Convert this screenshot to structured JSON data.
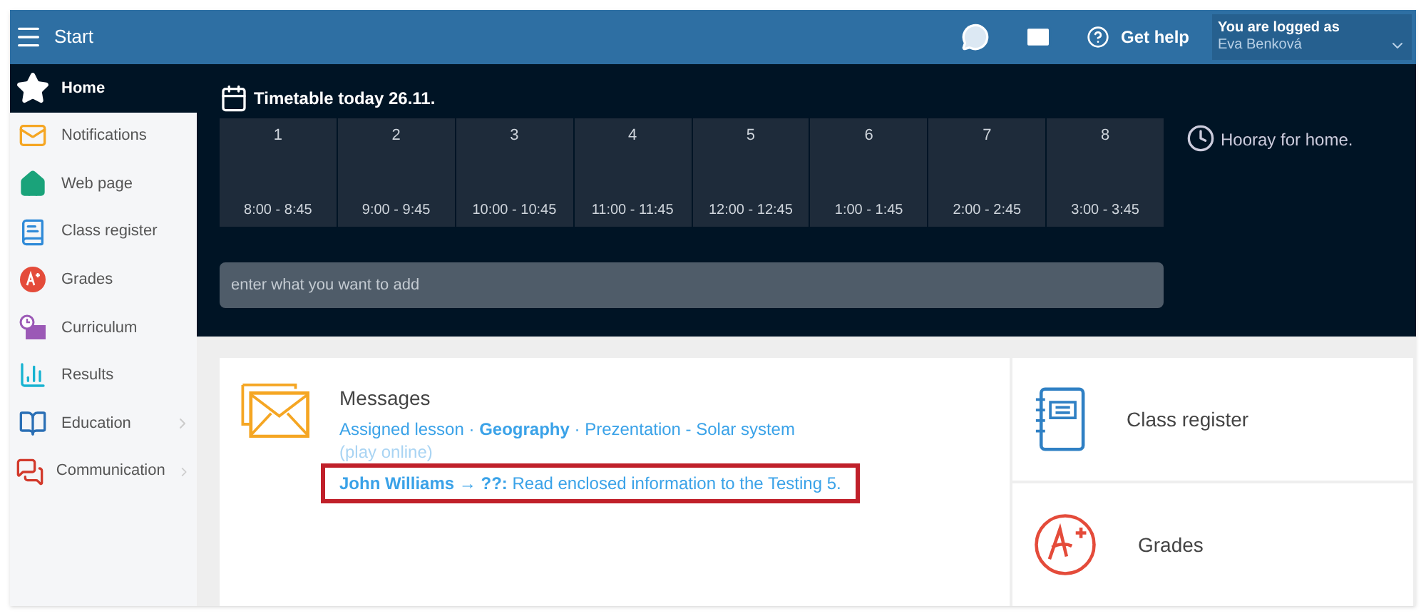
{
  "header": {
    "title": "Start",
    "help": "Get help",
    "user_label": "You are logged as",
    "user_name": "Eva Benková"
  },
  "sidebar": {
    "items": [
      {
        "label": "Home",
        "selected": true,
        "submenu": false
      },
      {
        "label": "Notifications",
        "selected": false,
        "submenu": false
      },
      {
        "label": "Web page",
        "selected": false,
        "submenu": false
      },
      {
        "label": "Class register",
        "selected": false,
        "submenu": false
      },
      {
        "label": "Grades",
        "selected": false,
        "submenu": false
      },
      {
        "label": "Curriculum",
        "selected": false,
        "submenu": false
      },
      {
        "label": "Results",
        "selected": false,
        "submenu": false
      },
      {
        "label": "Education",
        "selected": false,
        "submenu": true
      },
      {
        "label": "Communication",
        "selected": false,
        "submenu": true
      }
    ]
  },
  "timetable": {
    "title": "Timetable today 26.11.",
    "lessons": [
      {
        "number": "1",
        "time": "8:00 - 8:45"
      },
      {
        "number": "2",
        "time": "9:00 - 9:45"
      },
      {
        "number": "3",
        "time": "10:00 - 10:45"
      },
      {
        "number": "4",
        "time": "11:00 - 11:45"
      },
      {
        "number": "5",
        "time": "12:00 - 12:45"
      },
      {
        "number": "6",
        "time": "1:00 - 1:45"
      },
      {
        "number": "7",
        "time": "2:00 - 2:45"
      },
      {
        "number": "8",
        "time": "3:00 - 3:45"
      }
    ],
    "note": "Hooray for home.",
    "input": {
      "placeholder": "enter what you want to add"
    }
  },
  "messages": {
    "title": "Messages",
    "items": [
      {
        "text": "Assigned lesson · **Geography** · Prezentation - Solar system",
        "sub": "(play online)",
        "highlighted": false
      },
      {
        "text": "**John Williams → ??:** Read enclosed information to the Testing 5.",
        "highlighted": true
      }
    ]
  },
  "tiles": [
    {
      "label": "Class register"
    },
    {
      "label": "Grades"
    }
  ]
}
